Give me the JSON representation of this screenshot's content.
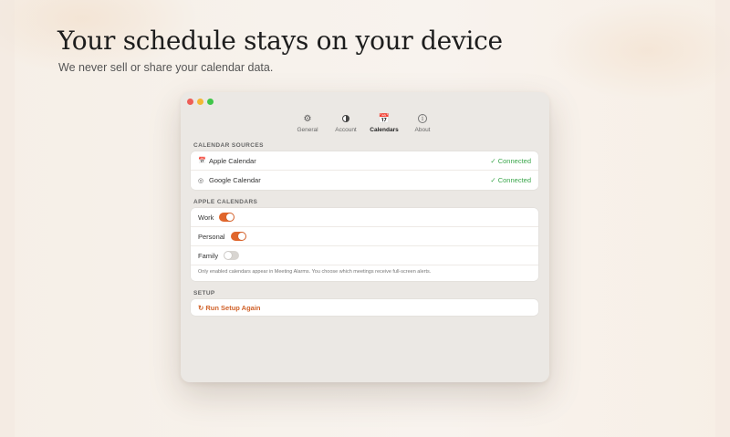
{
  "hero": {
    "headline": "Your schedule stays on your device",
    "subheadline": "We never sell or share your calendar data."
  },
  "window": {
    "tabs": [
      {
        "label": "General",
        "icon": "gear-icon",
        "glyph": "⚙",
        "active": false
      },
      {
        "label": "Account",
        "icon": "account-icon",
        "glyph": "",
        "active": false
      },
      {
        "label": "Calendars",
        "icon": "calendar-icon",
        "glyph": "📅",
        "active": true
      },
      {
        "label": "About",
        "icon": "info-icon",
        "glyph": "i",
        "active": false
      }
    ],
    "calendar_sources": {
      "title": "CALENDAR SOURCES",
      "items": [
        {
          "icon": "calendar-icon",
          "glyph": "📅",
          "name": "Apple Calendar",
          "status": "✓ Connected"
        },
        {
          "icon": "google-icon",
          "glyph": "◎",
          "name": "Google Calendar",
          "status": "✓ Connected"
        }
      ]
    },
    "apple_calendars": {
      "title": "APPLE CALENDARS",
      "items": [
        {
          "name": "Work",
          "enabled": true
        },
        {
          "name": "Personal",
          "enabled": true
        },
        {
          "name": "Family",
          "enabled": false
        }
      ],
      "note": "Only enabled calendars appear in Meeting Alarms. You choose which meetings receive full-screen alerts."
    },
    "setup": {
      "title": "SETUP",
      "run_again_label": "↻ Run Setup Again"
    }
  },
  "colors": {
    "accent": "#e0662c",
    "connected": "#3aa64b",
    "window_bg": "#ebe8e4"
  }
}
